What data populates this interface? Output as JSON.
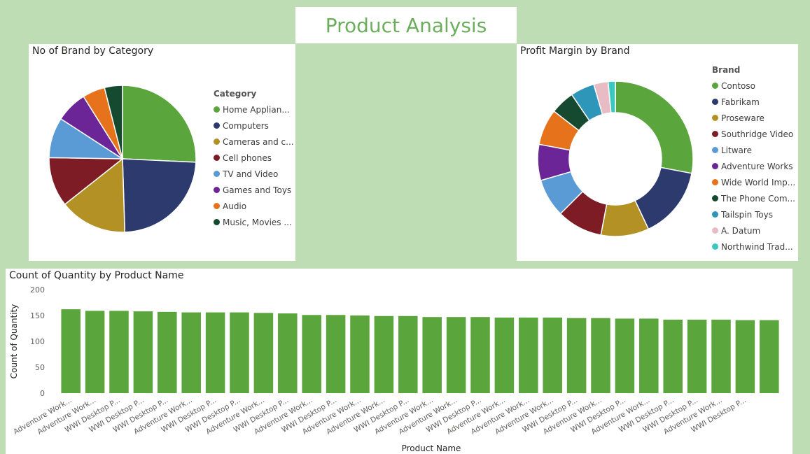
{
  "page": {
    "title": "Product Analysis"
  },
  "colors": {
    "background": "#bfddb5",
    "title": "#6cae5e",
    "bar": "#5aa53c"
  },
  "chart_data": [
    {
      "type": "pie",
      "title": "No of Brand by Category",
      "legend_title": "Category",
      "legend_position": "right",
      "labels": [
        "Home Applian...",
        "Computers",
        "Cameras and c...",
        "Cell phones",
        "TV and Video",
        "Games and Toys",
        "Audio",
        "Music, Movies ..."
      ],
      "values": [
        26,
        24,
        15,
        11,
        9,
        7,
        5,
        4
      ],
      "colors": [
        "#5aa53c",
        "#2d3a6e",
        "#b39124",
        "#7d1c25",
        "#5b9bd5",
        "#6b2596",
        "#e6721c",
        "#154a30"
      ]
    },
    {
      "type": "pie",
      "subtype": "donut",
      "title": "Profit Margin by Brand",
      "legend_title": "Brand",
      "legend_position": "right",
      "labels": [
        "Contoso",
        "Fabrikam",
        "Proseware",
        "Southridge Video",
        "Litware",
        "Adventure Works",
        "Wide World Imp...",
        "The Phone Com...",
        "Tailspin Toys",
        "A. Datum",
        "Northwind Trad..."
      ],
      "values": [
        28,
        15,
        10,
        9.5,
        8,
        7.5,
        7.5,
        5,
        5,
        3,
        1.5
      ],
      "colors": [
        "#5aa53c",
        "#2d3a6e",
        "#b39124",
        "#7d1c25",
        "#5b9bd5",
        "#6b2596",
        "#e6721c",
        "#154a30",
        "#2e96b8",
        "#e8bcc4",
        "#3cc8c0"
      ]
    },
    {
      "type": "bar",
      "title": "Count of Quantity by Product Name",
      "xlabel": "Product Name",
      "ylabel": "Count of Quantity",
      "ylim": [
        0,
        200
      ],
      "yticks": [
        0,
        50,
        100,
        150,
        200
      ],
      "categories": [
        "Adventure Work...",
        "Adventure Work...",
        "WWI Desktop P...",
        "WWI Desktop P...",
        "WWI Desktop P...",
        "Adventure Work...",
        "WWI Desktop P...",
        "WWI Desktop P...",
        "Adventure Work...",
        "WWI Desktop P...",
        "Adventure Work...",
        "WWI Desktop P...",
        "Adventure Work...",
        "Adventure Work...",
        "WWI Desktop P...",
        "Adventure Work...",
        "Adventure Work...",
        "WWI Desktop P...",
        "Adventure Work...",
        "Adventure Work...",
        "Adventure Work...",
        "WWI Desktop P...",
        "Adventure Work...",
        "WWI Desktop P...",
        "Adventure Work...",
        "WWI Desktop P...",
        "WWI Desktop P...",
        "Adventure Work...",
        "WWI Desktop P..."
      ],
      "values": [
        162,
        159,
        159,
        158,
        157,
        156,
        156,
        156,
        155,
        154,
        151,
        151,
        150,
        149,
        149,
        147,
        147,
        147,
        146,
        146,
        146,
        145,
        145,
        144,
        144,
        142,
        142,
        142,
        141,
        141
      ],
      "grid": false
    }
  ]
}
